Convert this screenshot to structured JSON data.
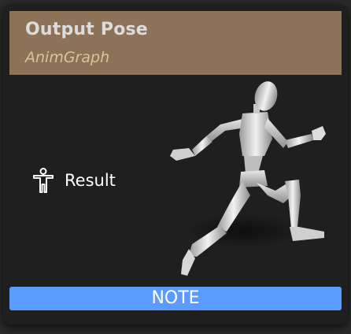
{
  "node": {
    "title": "Output Pose",
    "subtitle": "AnimGraph",
    "header_color": "#8c7257",
    "pins": [
      {
        "label": "Result",
        "icon": "pose-pin-icon"
      }
    ],
    "preview_icon": "running-mannequin-icon",
    "note_label": "NOTE",
    "note_color": "#5b9bff"
  }
}
